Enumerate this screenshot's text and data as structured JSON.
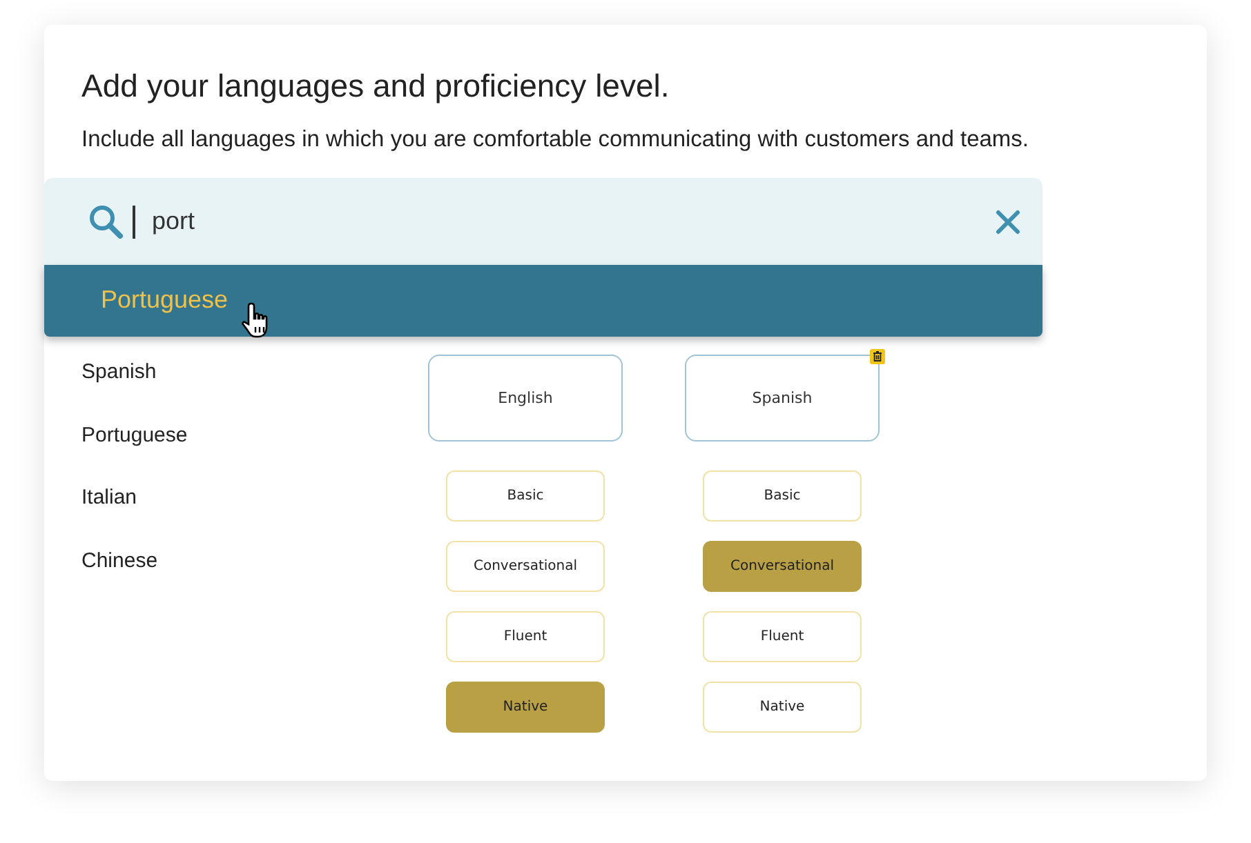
{
  "title": "Add your languages and proficiency level.",
  "subtitle": "Include all languages in which you are comfortable communicating with customers and teams.",
  "search": {
    "value": "port"
  },
  "suggestions": [
    {
      "label": "Portuguese",
      "selected": true
    }
  ],
  "languages": [
    "Spanish",
    "Portuguese",
    "Italian",
    "Chinese"
  ],
  "chosen": [
    {
      "name": "English",
      "show_delete": false,
      "levels": [
        {
          "label": "Basic",
          "selected": false
        },
        {
          "label": "Conversational",
          "selected": false
        },
        {
          "label": "Fluent",
          "selected": false
        },
        {
          "label": "Native",
          "selected": true
        }
      ]
    },
    {
      "name": "Spanish",
      "show_delete": true,
      "levels": [
        {
          "label": "Basic",
          "selected": false
        },
        {
          "label": "Conversational",
          "selected": true
        },
        {
          "label": "Fluent",
          "selected": false
        },
        {
          "label": "Native",
          "selected": false
        }
      ]
    }
  ]
}
